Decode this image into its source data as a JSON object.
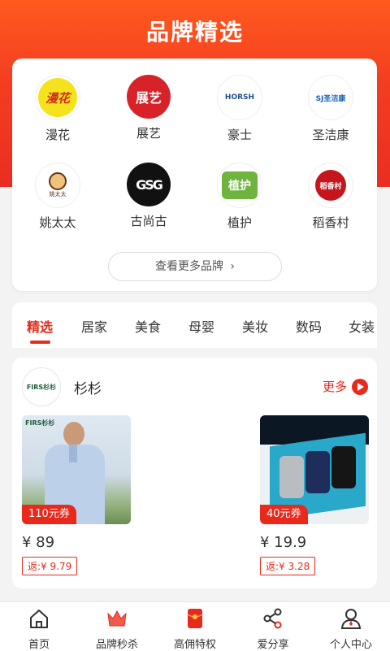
{
  "header": {
    "title": "品牌精选"
  },
  "brands": [
    {
      "name": "漫花",
      "logo_text": "漫花",
      "icon": "manhua-logo",
      "bg": "#fff"
    },
    {
      "name": "展艺",
      "logo_text": "展艺",
      "icon": "zhanyi-logo",
      "bg": "#d8222a"
    },
    {
      "name": "豪士",
      "logo_text": "HORSH",
      "icon": "haoshi-logo",
      "bg": "#fff"
    },
    {
      "name": "圣洁康",
      "logo_text": "SJ圣洁康",
      "icon": "shengjiekang-logo",
      "bg": "#fff"
    },
    {
      "name": "姚太太",
      "logo_text": "姚太太",
      "icon": "yaotaitai-logo",
      "bg": "#fff"
    },
    {
      "name": "古尚古",
      "logo_text": "GSG",
      "icon": "gushanggu-logo",
      "bg": "#111"
    },
    {
      "name": "植护",
      "logo_text": "植护",
      "icon": "zhihu-logo",
      "bg": "#6fb43e"
    },
    {
      "name": "稻香村",
      "logo_text": "稻香村",
      "icon": "daoxiangcun-logo",
      "bg": "#fff"
    }
  ],
  "more_brands_label": "查看更多品牌",
  "tabs": [
    "精选",
    "居家",
    "美食",
    "母婴",
    "美妆",
    "数码",
    "女装"
  ],
  "active_tab": "精选",
  "store": {
    "name": "杉杉",
    "logo_text": "FIRS杉杉",
    "more_label": "更多",
    "products": [
      {
        "coupon": "110元券",
        "price": "¥ 89",
        "rebate": "返:¥ 9.79",
        "image": "shirt-photo"
      },
      {
        "coupon": "40元券",
        "price": "¥ 19.9",
        "rebate": "返:¥ 3.28",
        "image": "underwear-box-photo"
      }
    ]
  },
  "tabbar": [
    {
      "label": "首页",
      "icon": "home-icon"
    },
    {
      "label": "品牌秒杀",
      "icon": "crown-icon"
    },
    {
      "label": "高佣特权",
      "icon": "red-envelope-icon"
    },
    {
      "label": "爱分享",
      "icon": "share-icon"
    },
    {
      "label": "个人中心",
      "icon": "user-icon"
    }
  ],
  "colors": {
    "accent": "#e8291c",
    "hero_top": "#ff5a1f",
    "hero_bottom": "#ea2e22"
  }
}
